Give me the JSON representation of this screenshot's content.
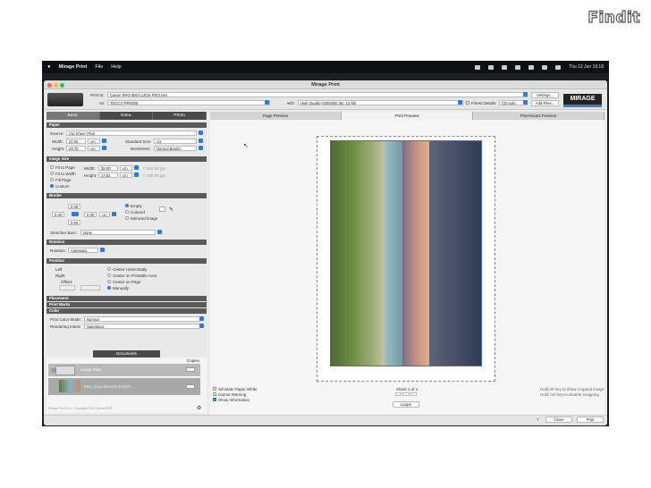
{
  "watermark": {
    "logo": "Findit"
  },
  "menubar": {
    "app": "Mirage Print",
    "items": [
      "File",
      "Help"
    ],
    "datetime": "Thu 12 Jan  19:18"
  },
  "window": {
    "title": "Mirage Print"
  },
  "controls": {
    "print_to_label": "Print to:",
    "printer": "Canon PRO-300 (LUCIA PRO Ink)",
    "profile_label": "on:",
    "profile": "TECCO PFR295",
    "with_label": "with",
    "quality": "High Quality (600x600 dpi, 12-bit)",
    "finest_label": "Finest Details",
    "cd_label": "CD Auto",
    "settings_button": "Settings...",
    "add_files_button": "Add Files...",
    "brand": "MIRAGE"
  },
  "left_tabs": [
    "Basic",
    "Extra",
    "Photo"
  ],
  "paper": {
    "header": "Paper",
    "source_label": "Source:",
    "source": "Cut Sheet (Top)",
    "width_label": "Width:",
    "width": "21.00",
    "height_label": "Height:",
    "height": "29.70",
    "unit": "cm",
    "std_label": "Standard Size:",
    "std_size": "A4",
    "borderless_label": "Borderless:",
    "borderless": "Normal Border"
  },
  "image_size": {
    "header": "Image Size",
    "options": [
      "Fit to Page",
      "Fit to Width",
      "Fill Page",
      "Custom"
    ],
    "width_label": "Width:",
    "width": "38.00",
    "height_label": "Height:",
    "height": "17.54",
    "unit": "cm",
    "ppi1": "□ 150.00 ppi",
    "ppi2": "□ 150.00 ppi"
  },
  "border": {
    "header": "Border",
    "top": "0.00",
    "left": "0.00",
    "right": "0.00",
    "bottom": "0.00",
    "unit": "cm",
    "options": [
      "Empty",
      "Colored",
      "Mirrored image"
    ],
    "stretcher_label": "Stretcher Bars:",
    "stretcher": "None"
  },
  "rotation": {
    "header": "Rotation",
    "label": "Rotation:",
    "value": "Automatic"
  },
  "position": {
    "header": "Position",
    "left": "Left",
    "right": "Right",
    "offset": "Offset:",
    "opts": [
      "Center Horizontally",
      "Center on Printable Area",
      "Center on Page",
      "Manually"
    ]
  },
  "placement": {
    "header": "Placement"
  },
  "printmarks": {
    "header": "Print Marks"
  },
  "color": {
    "header": "Color",
    "mode_label": "Print Color Mode:",
    "mode": "Normal",
    "intent_label": "Rendering Intent:",
    "intent": "Saturation"
  },
  "documents": {
    "tab": "Documents",
    "copies_label": "Copies",
    "item1": "Image Files",
    "item2": "IMG_xxxx-final-print-2023...",
    "version": "Mirage Pro 5.0.4 - Copyright 2023 Dinkel GbR"
  },
  "preview": {
    "tabs": [
      "Page Preview",
      "Print Preview",
      "Pixel-Exact Preview"
    ],
    "sheet": "Sheet 1 of 1",
    "loupe": "Loupe",
    "options": [
      "Simulate Paper White",
      "Gamut Warning",
      "Show Information"
    ],
    "hint1": "Hold Alt key to show cropped image",
    "hint2": "Hold Ctrl key to disable snapping"
  },
  "footer": {
    "help": "?",
    "close": "Close",
    "print": "Print"
  }
}
